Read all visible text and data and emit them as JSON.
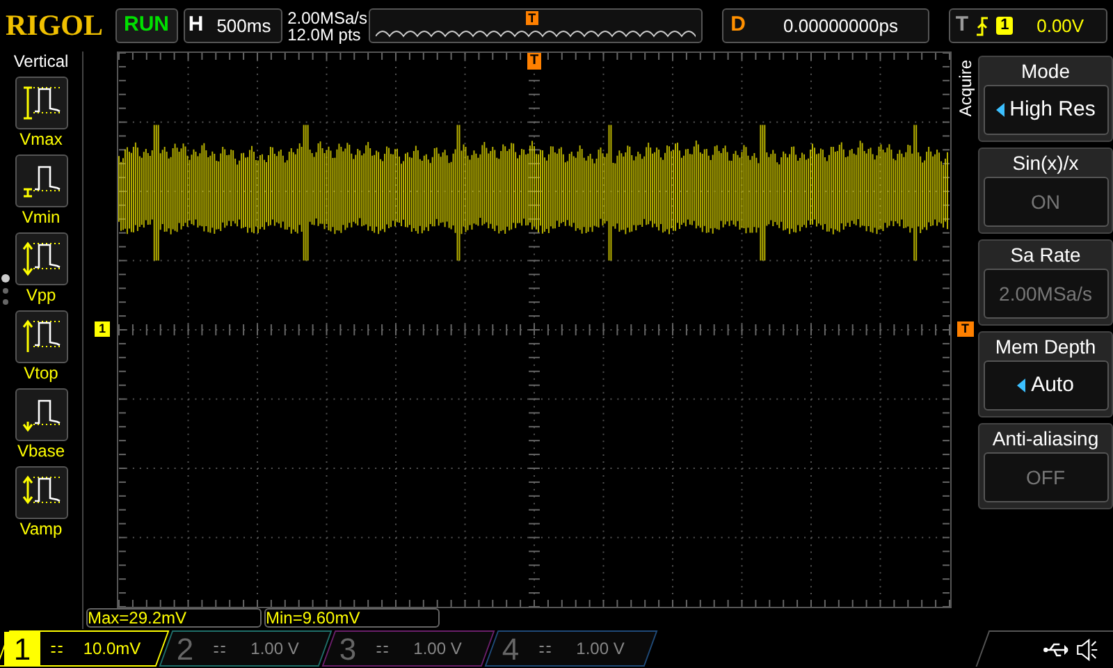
{
  "brand": "RIGOL",
  "run_status": {
    "label": "RUN",
    "running": true
  },
  "horizontal": {
    "label": "H",
    "value": "500ms"
  },
  "sampling": {
    "rate": "2.00MSa/s",
    "points": "12.0M pts"
  },
  "delay": {
    "label": "D",
    "value": "0.00000000ps"
  },
  "trigger": {
    "label": "T",
    "channel": "1",
    "level": "0.00V"
  },
  "measure_menu": {
    "title": "Vertical",
    "items": [
      {
        "label": "Vmax",
        "kind": "max"
      },
      {
        "label": "Vmin",
        "kind": "min"
      },
      {
        "label": "Vpp",
        "kind": "pp"
      },
      {
        "label": "Vtop",
        "kind": "top"
      },
      {
        "label": "Vbase",
        "kind": "base"
      },
      {
        "label": "Vamp",
        "kind": "amp"
      }
    ],
    "pages": [
      {
        "selected": true
      },
      {
        "selected": false
      },
      {
        "selected": false
      }
    ]
  },
  "markers": {
    "overview_trigger": "T",
    "trigger_position": "T",
    "channel": "1",
    "trigger_level": "T"
  },
  "acquire_menu": {
    "title": "Acquire",
    "items": [
      {
        "label": "Mode",
        "value": "High Res",
        "disabled": false,
        "has_options": true
      },
      {
        "label": "Sin(x)/x",
        "value": "ON",
        "disabled": true,
        "has_options": false
      },
      {
        "label": "Sa Rate",
        "value": "2.00MSa/s",
        "disabled": true,
        "has_options": false
      },
      {
        "label": "Mem Depth",
        "value": "Auto",
        "disabled": false,
        "has_options": true
      },
      {
        "label": "Anti-aliasing",
        "value": "OFF",
        "disabled": true,
        "has_options": false
      }
    ]
  },
  "measurements": [
    "Max=29.2mV",
    "Min=9.60mV"
  ],
  "channels": [
    {
      "number": "1",
      "scale": "10.0mV",
      "active": true,
      "color": "#ffff00"
    },
    {
      "number": "2",
      "scale": "1.00 V",
      "active": false,
      "color": "#1f6f6a"
    },
    {
      "number": "3",
      "scale": "1.00 V",
      "active": false,
      "color": "#6a1f6a"
    },
    {
      "number": "4",
      "scale": "1.00 V",
      "active": false,
      "color": "#1f4a78"
    }
  ]
}
